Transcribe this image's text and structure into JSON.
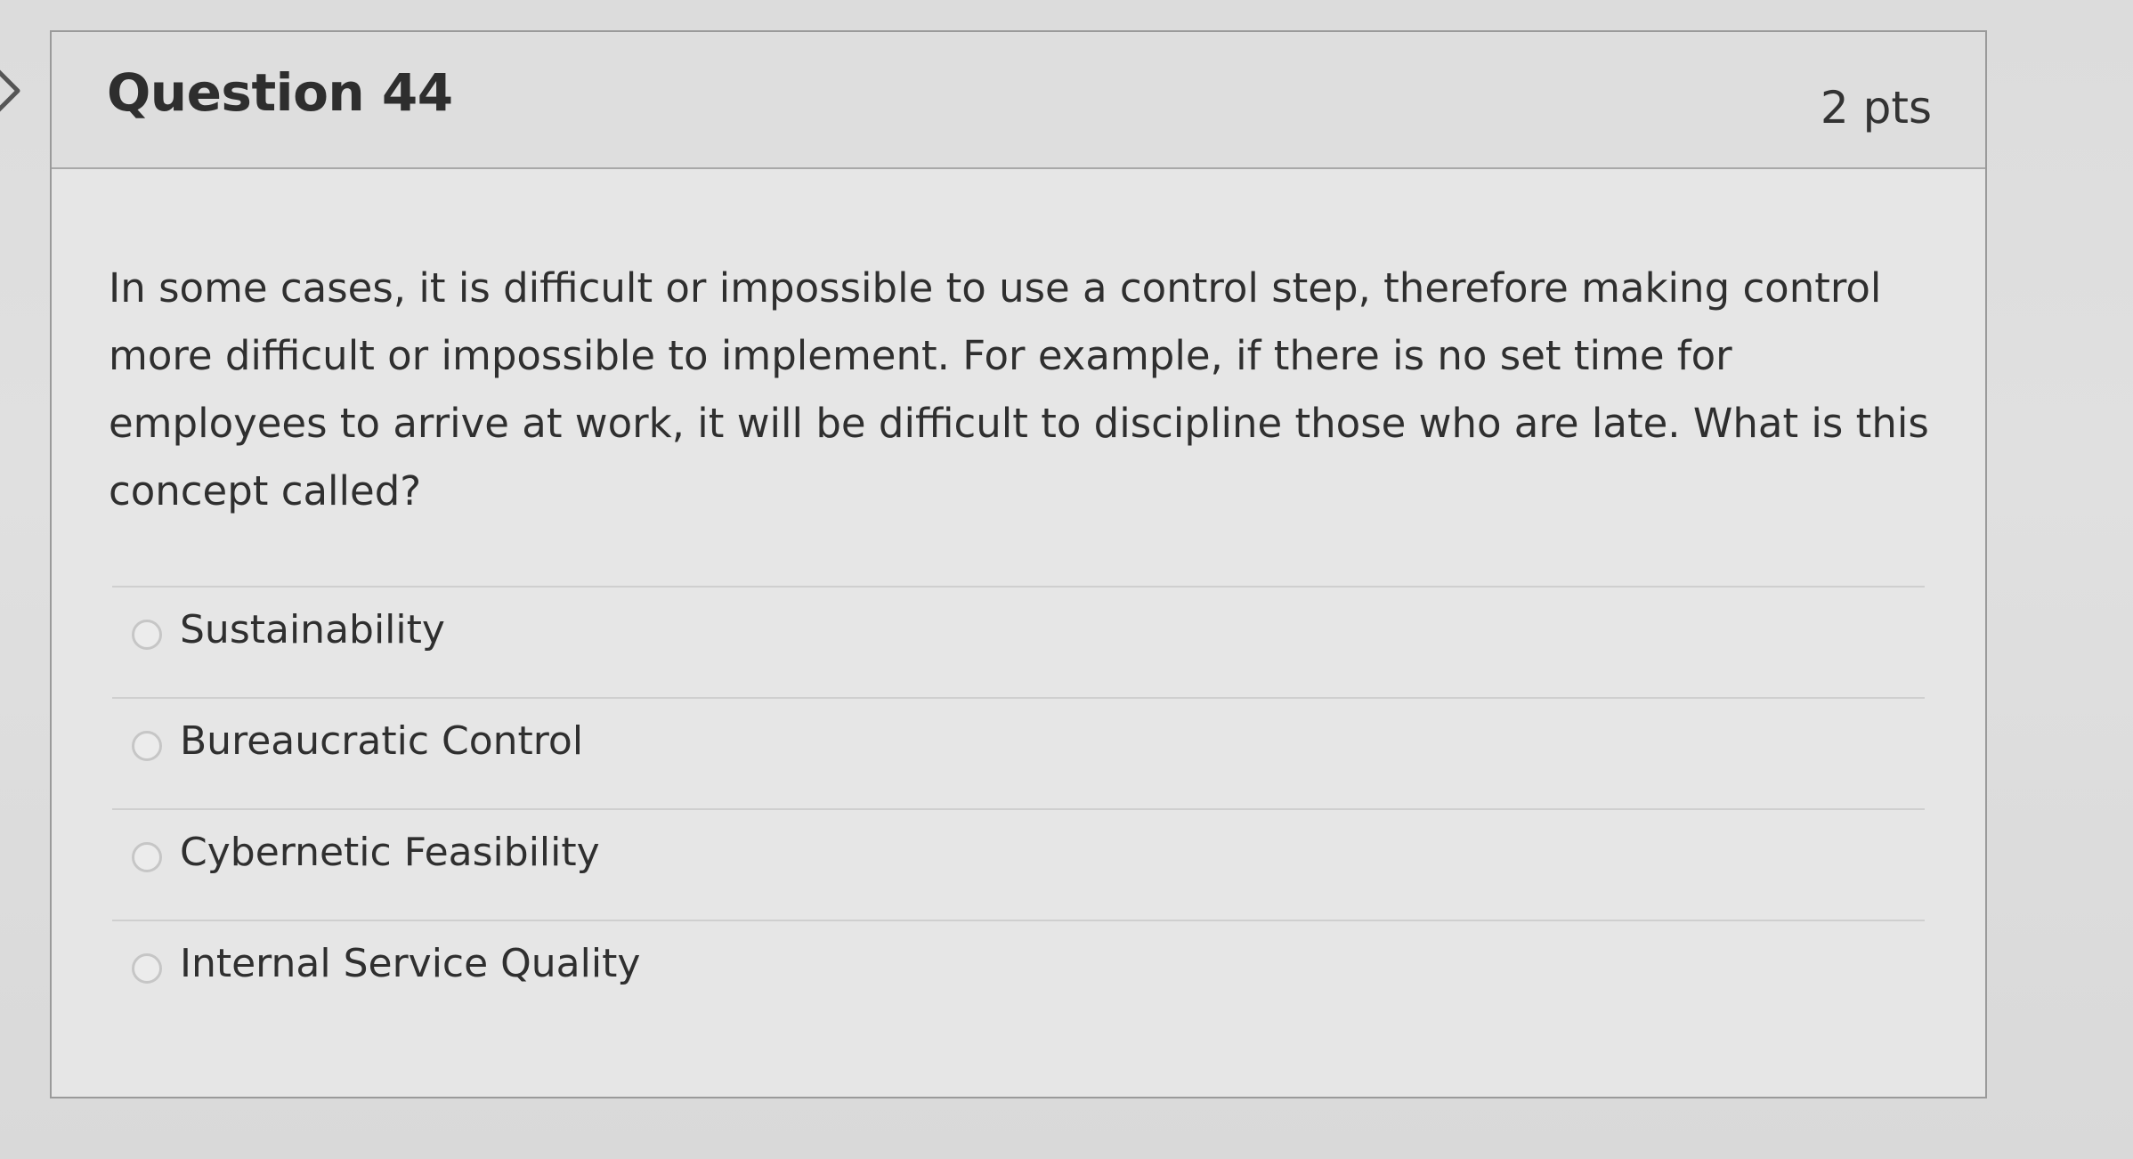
{
  "question": {
    "title": "Question 44",
    "points": "2 pts",
    "text": "In some cases, it is difficult or impossible to use a control step, therefore making control more difficult or impossible to implement. For example, if there is no set time for employees to arrive at work, it will be difficult to discipline those who are late. What is this concept called?"
  },
  "answers": [
    {
      "label": "Sustainability",
      "selected": false
    },
    {
      "label": "Bureaucratic Control",
      "selected": false
    },
    {
      "label": "Cybernetic Feasibility",
      "selected": false
    },
    {
      "label": "Internal Service Quality",
      "selected": false
    }
  ],
  "icons": {
    "nav": "chevron-right-icon",
    "option": "radio-icon"
  },
  "colors": {
    "background": "#dcdcdc",
    "card": "#e6e6e6",
    "header": "#dedede",
    "text": "#2d2d2d",
    "divider": "#cfcfcf"
  }
}
